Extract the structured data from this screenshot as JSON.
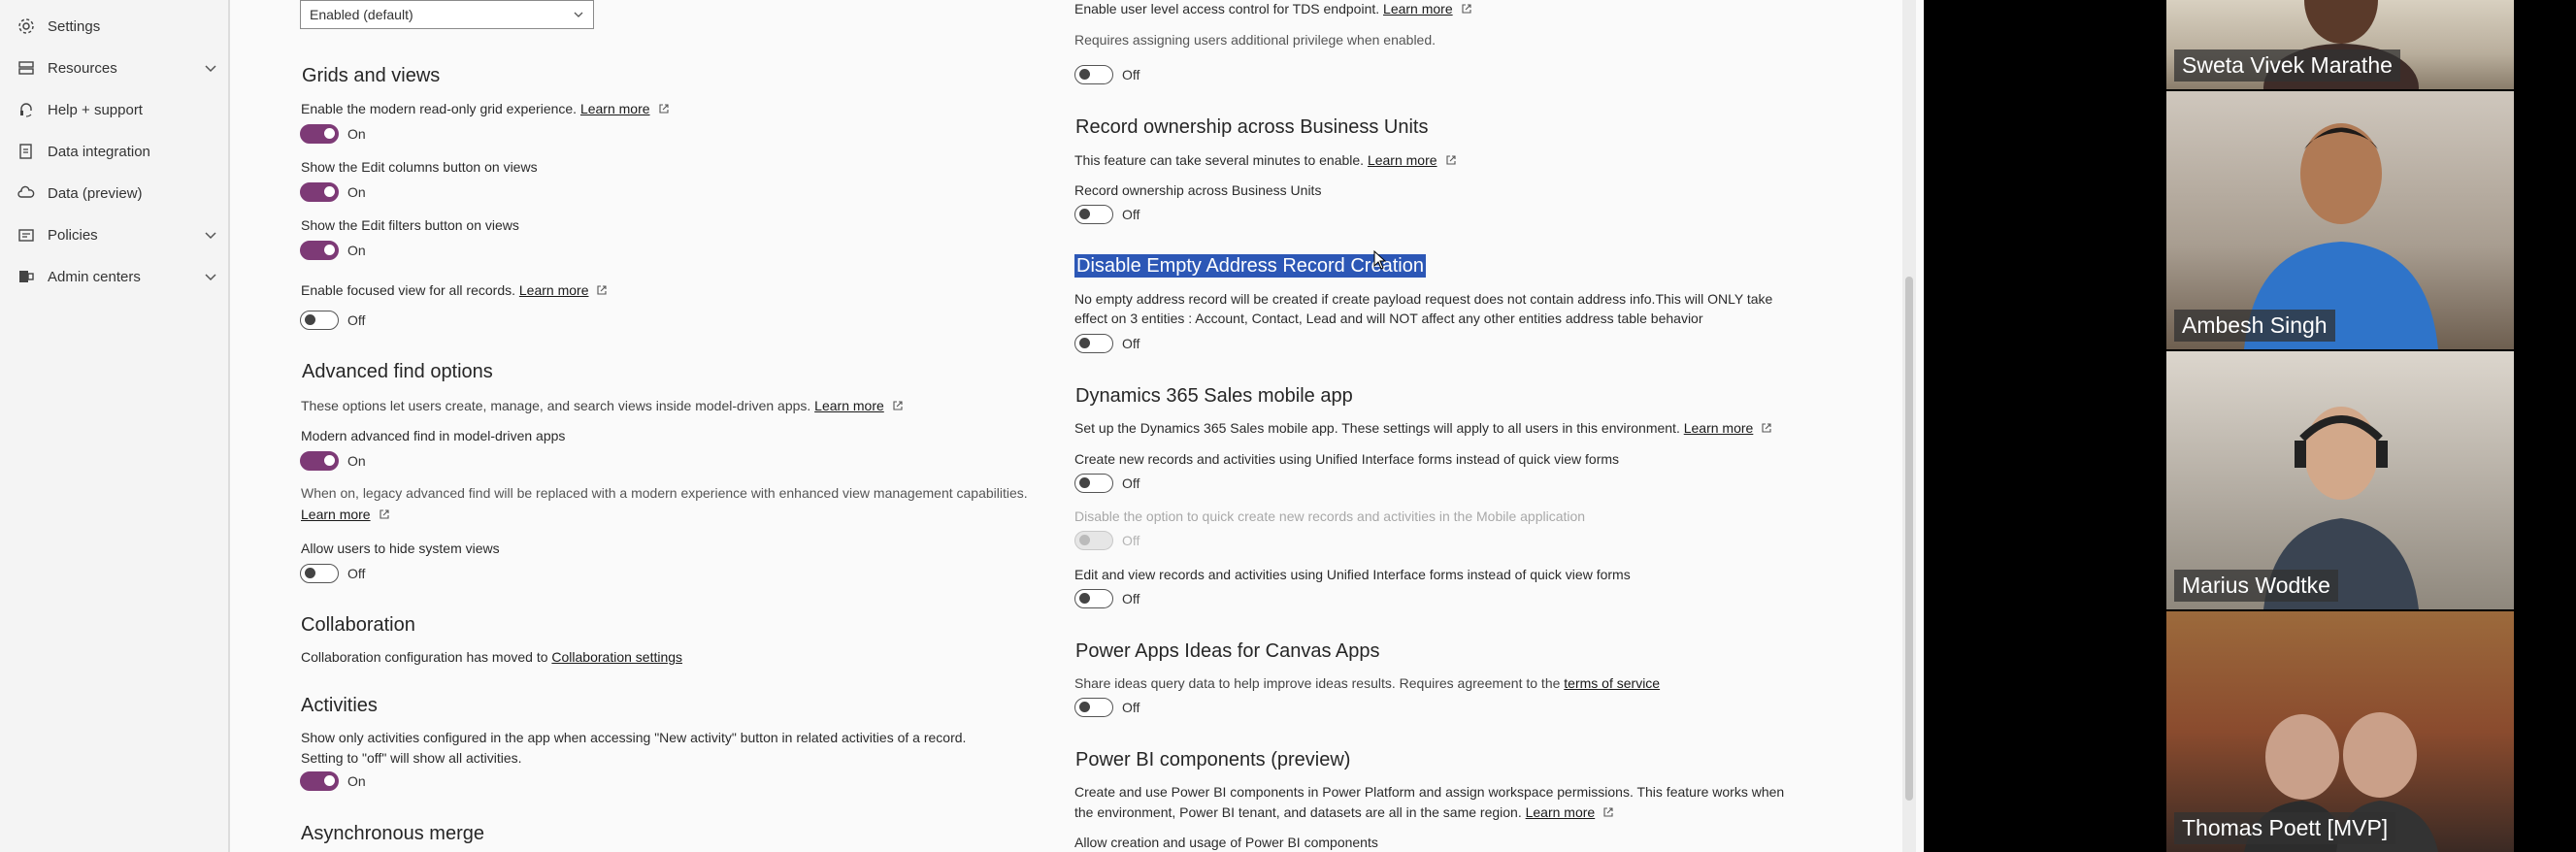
{
  "sidebar": {
    "items": [
      {
        "label": "Settings",
        "icon": "gear-icon",
        "chevron": false
      },
      {
        "label": "Resources",
        "icon": "server-icon",
        "chevron": true
      },
      {
        "label": "Help + support",
        "icon": "headset-icon",
        "chevron": false
      },
      {
        "label": "Data integration",
        "icon": "data-integration-icon",
        "chevron": false
      },
      {
        "label": "Data (preview)",
        "icon": "cloud-data-icon",
        "chevron": false
      },
      {
        "label": "Policies",
        "icon": "policy-icon",
        "chevron": true
      },
      {
        "label": "Admin centers",
        "icon": "admin-centers-icon",
        "chevron": true
      }
    ]
  },
  "left": {
    "dropdown_value": "Enabled (default)",
    "grids": {
      "title": "Grids and views",
      "modern_grid_text": "Enable the modern read-only grid experience.",
      "modern_grid_toggle": "On",
      "edit_columns_text": "Show the Edit columns button on views",
      "edit_columns_toggle": "On",
      "edit_filters_text": "Show the Edit filters button on views",
      "edit_filters_toggle": "On",
      "focused_view_text": "Enable focused view for all records.",
      "focused_view_toggle": "Off"
    },
    "advanced_find": {
      "title": "Advanced find options",
      "desc": "These options let users create, manage, and search views inside model-driven apps.",
      "modern_label": "Modern advanced find in model-driven apps",
      "modern_toggle": "On",
      "note": "When on, legacy advanced find will be replaced with a modern experience with enhanced view management capabilities.",
      "hide_views_label": "Allow users to hide system views",
      "hide_views_toggle": "Off"
    },
    "collaboration": {
      "title": "Collaboration",
      "text": "Collaboration configuration has moved to",
      "link": "Collaboration settings"
    },
    "activities": {
      "title": "Activities",
      "line1": "Show only activities configured in the app when accessing \"New activity\" button in related activities of a record.",
      "line2": "Setting to \"off\" will show all activities.",
      "toggle": "On"
    },
    "async_merge_title": "Asynchronous merge"
  },
  "right": {
    "tds": {
      "text": "Enable user level access control for TDS endpoint.",
      "sub": "Requires assigning users additional privilege when enabled.",
      "toggle": "Off"
    },
    "ownership": {
      "title": "Record ownership across Business Units",
      "desc": "This feature can take several minutes to enable.",
      "label": "Record ownership across Business Units",
      "toggle": "Off"
    },
    "empty_address": {
      "title": "Disable Empty Address Record Creation",
      "line1": "No empty address record will be created if create payload request does not contain address info.This will ONLY take",
      "line2": "effect on 3 entities : Account, Contact, Lead and will NOT affect any other entities address table behavior",
      "toggle": "Off"
    },
    "sales_mobile": {
      "title": "Dynamics 365 Sales mobile app",
      "desc": "Set up the Dynamics 365 Sales mobile app. These settings will apply to all users in this environment.",
      "create_label": "Create new records and activities using Unified Interface forms instead of quick view forms",
      "create_toggle": "Off",
      "quick_create_label": "Disable the option to quick create new records and activities in the Mobile application",
      "quick_create_toggle": "Off",
      "edit_label": "Edit and view records and activities using Unified Interface forms instead of quick view forms",
      "edit_toggle": "Off"
    },
    "ideas": {
      "title": "Power Apps Ideas for Canvas Apps",
      "desc": "Share ideas query data to help improve ideas results. Requires agreement to the",
      "link": "terms of service",
      "toggle": "Off"
    },
    "powerbi": {
      "title": "Power BI components (preview)",
      "line1": "Create and use Power BI components in Power Platform and assign workspace permissions. This feature works when",
      "line2": "the environment, Power BI tenant, and datasets are all in the same region.",
      "allow_label": "Allow creation and usage of Power BI components"
    }
  },
  "learn_more": "Learn more",
  "participants": [
    {
      "name": "Sweta Vivek Marathe"
    },
    {
      "name": "Ambesh Singh"
    },
    {
      "name": "Marius Wodtke"
    },
    {
      "name": "Thomas Poett [MVP]"
    }
  ],
  "colors": {
    "toggle_on": "#7d3a76",
    "selection_highlight": "#2c57b6"
  }
}
